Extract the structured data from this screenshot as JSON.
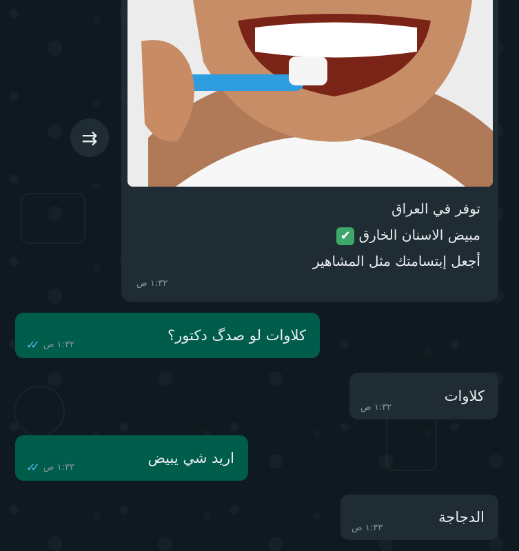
{
  "chat": {
    "image_message": {
      "caption_lines": [
        "توفر في العراق",
        "مبيض الاسنان الخارق",
        "أجعل إبتسامتك مثل المشاهير"
      ],
      "caption_emoji": "✔",
      "time": "١:٣٢ ص"
    },
    "forward_icon": "⇉",
    "messages": [
      {
        "direction": "out",
        "text": "كلاوات لو صدگ دكتور؟",
        "time": "١:٣٢ ص",
        "status": "read"
      },
      {
        "direction": "in",
        "text": "كلاوات",
        "time": "١:٣٢ ص"
      },
      {
        "direction": "out",
        "text": "اريد شي يبيض",
        "time": "١:٣٣ ص",
        "status": "read"
      },
      {
        "direction": "in",
        "text": "الدجاجة",
        "time": "١:٣٣ ص"
      }
    ],
    "colors": {
      "background": "#0b141a",
      "incoming_bubble": "#1f2c34",
      "outgoing_bubble": "#005c4b",
      "read_ticks": "#53bdeb",
      "timestamp": "#8696a0"
    }
  }
}
